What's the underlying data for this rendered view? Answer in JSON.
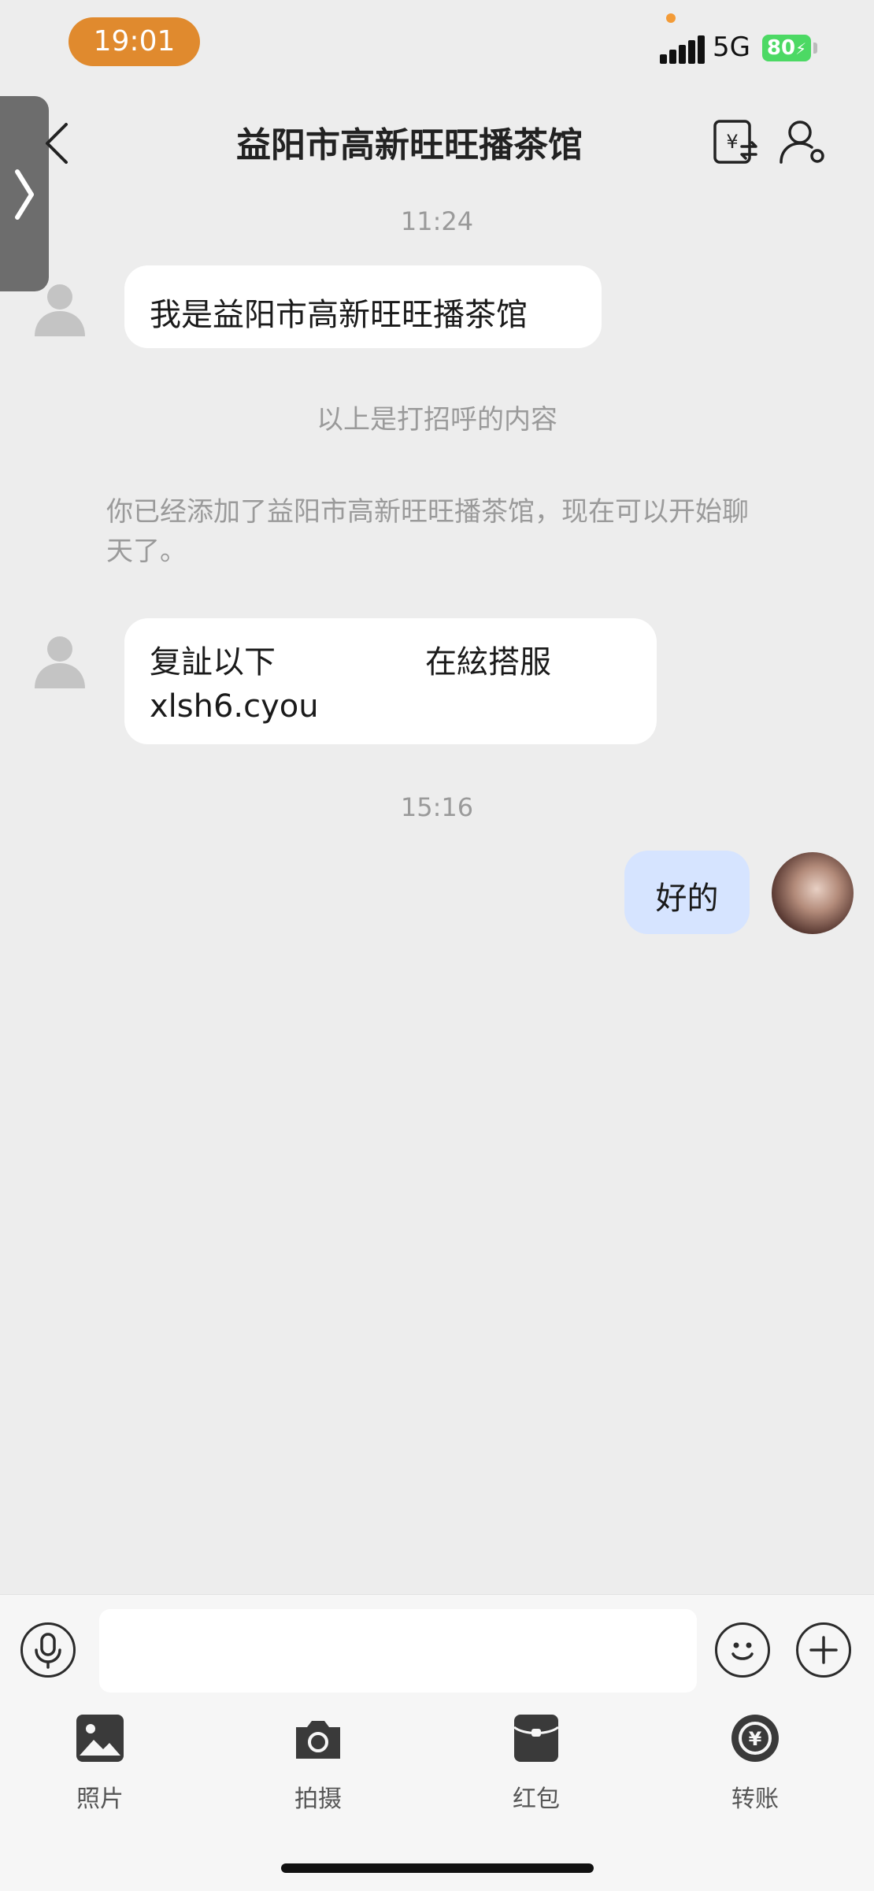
{
  "status_bar": {
    "time": "19:01",
    "network": "5G",
    "battery": "80",
    "battery_charging": true,
    "signal_icon": "cellular-signal-icon"
  },
  "header": {
    "title": "益阳市高新旺旺播茶馆",
    "back_icon": "chevron-left-icon",
    "transfer_icon": "yuan-transfer-icon",
    "profile_icon": "person-settings-icon"
  },
  "messages": [
    {
      "type": "timestamp",
      "text": "11:24"
    },
    {
      "type": "incoming",
      "text": "我是益阳市高新旺旺播茶馆"
    },
    {
      "type": "system",
      "text": "以上是打招呼的内容"
    },
    {
      "type": "system",
      "text": "你已经添加了益阳市高新旺旺播茶馆，现在可以开始聊天了。"
    },
    {
      "type": "incoming",
      "line1": "复訨以下",
      "line1b": "在絃搭服",
      "line2": "xlsh6.cyou"
    },
    {
      "type": "timestamp",
      "text": "15:16"
    },
    {
      "type": "outgoing",
      "text": "好的"
    }
  ],
  "input_bar": {
    "voice_icon": "microphone-icon",
    "emoji_icon": "emoji-icon",
    "plus_icon": "plus-icon",
    "value": ""
  },
  "tools": [
    {
      "label": "照片",
      "icon": "photo-icon"
    },
    {
      "label": "拍摄",
      "icon": "camera-icon"
    },
    {
      "label": "红包",
      "icon": "red-envelope-icon"
    },
    {
      "label": "转账",
      "icon": "transfer-icon"
    }
  ],
  "colors": {
    "time_pill": "#e08a2e",
    "battery": "#4cd964",
    "self_bubble": "#d6e4ff",
    "background": "#ededed"
  }
}
